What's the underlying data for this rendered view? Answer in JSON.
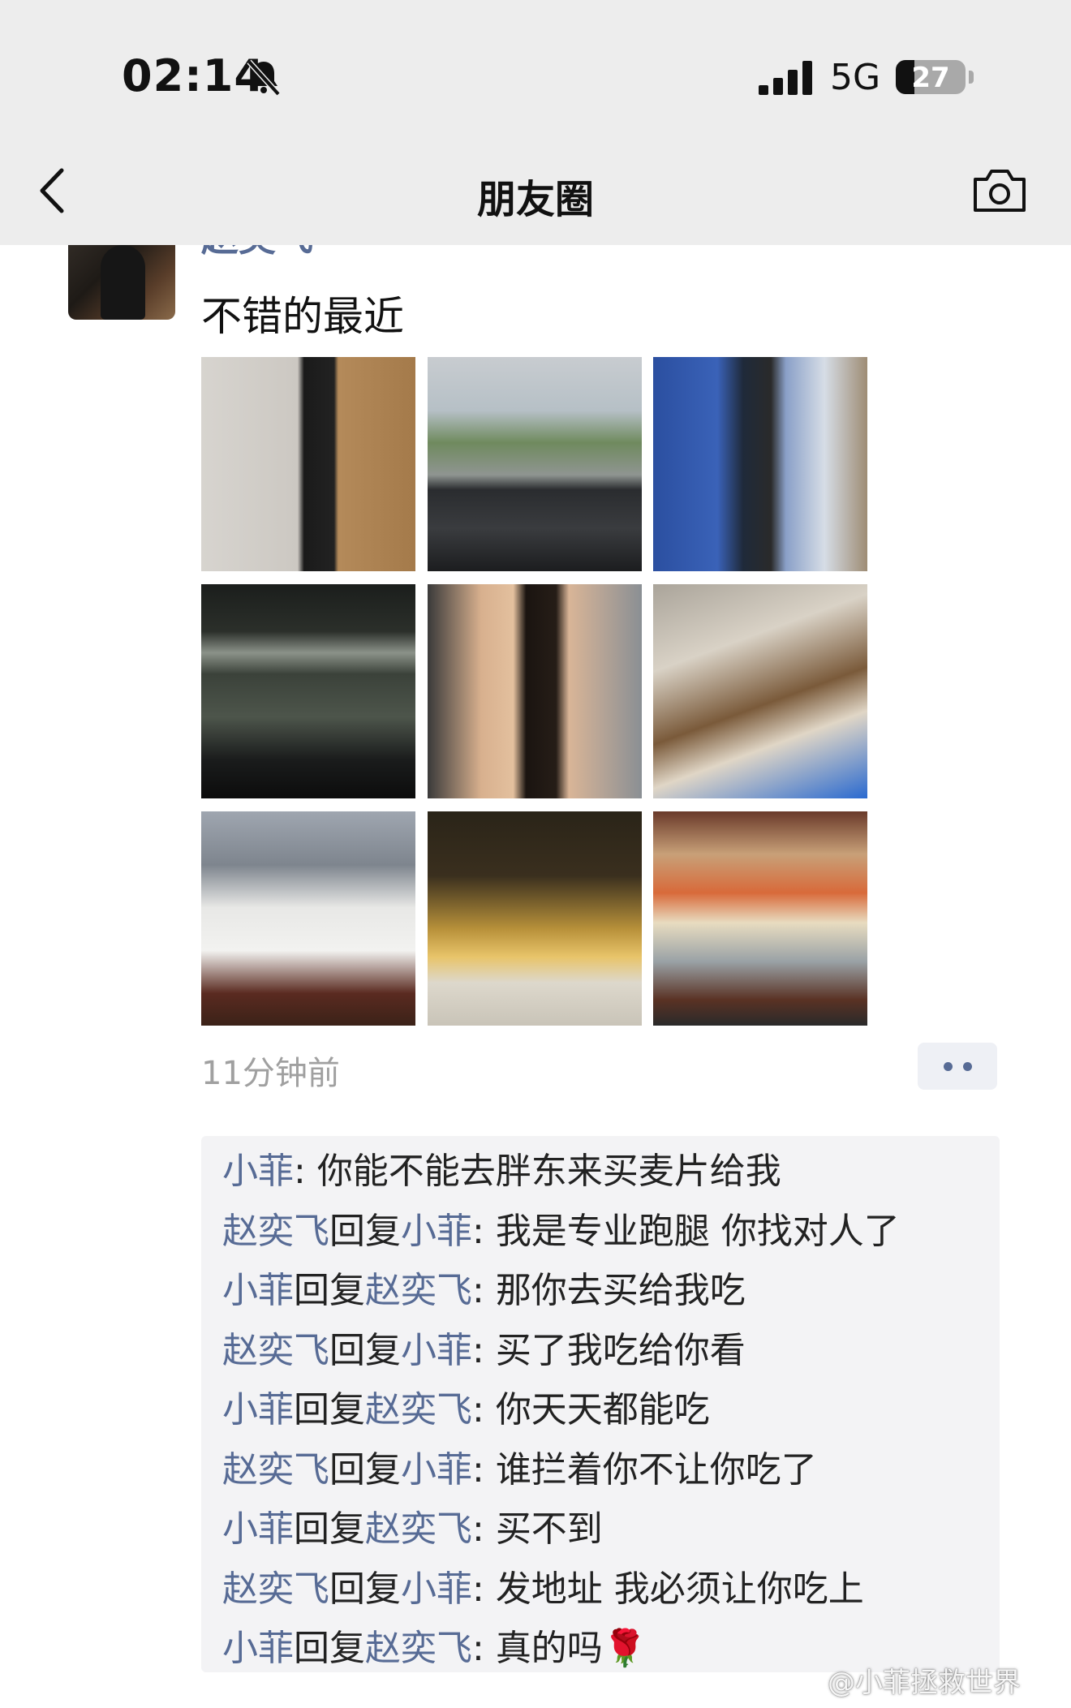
{
  "status_bar": {
    "time": "02:14",
    "network": "5G",
    "battery": "27",
    "battery_level": 0.27
  },
  "nav": {
    "title": "朋友圈"
  },
  "post": {
    "author": "赵奕飞",
    "text": "不错的最近",
    "timestamp": "11分钟前"
  },
  "comments": [
    {
      "name": "小菲",
      "reply_word": "",
      "reply_to": "",
      "sep": ": ",
      "text": "你能不能去胖东来买麦片给我"
    },
    {
      "name": "赵奕飞",
      "reply_word": "回复",
      "reply_to": "小菲",
      "sep": ": ",
      "text": "我是专业跑腿 你找对人了"
    },
    {
      "name": "小菲",
      "reply_word": "回复",
      "reply_to": "赵奕飞",
      "sep": ": ",
      "text": "那你去买给我吃"
    },
    {
      "name": "赵奕飞",
      "reply_word": "回复",
      "reply_to": "小菲",
      "sep": ": ",
      "text": "买了我吃给你看"
    },
    {
      "name": "小菲",
      "reply_word": "回复",
      "reply_to": "赵奕飞",
      "sep": ": ",
      "text": "你天天都能吃"
    },
    {
      "name": "赵奕飞",
      "reply_word": "回复",
      "reply_to": "小菲",
      "sep": ": ",
      "text": "谁拦着你不让你吃了"
    },
    {
      "name": "小菲",
      "reply_word": "回复",
      "reply_to": "赵奕飞",
      "sep": ": ",
      "text": "买不到"
    },
    {
      "name": "赵奕飞",
      "reply_word": "回复",
      "reply_to": "小菲",
      "sep": ": ",
      "text": "发地址 我必须让你吃上"
    },
    {
      "name": "小菲",
      "reply_word": "回复",
      "reply_to": "赵奕飞",
      "sep": ": ",
      "text": "真的吗🌹"
    }
  ],
  "watermark": "@小菲拯救世界",
  "colors": {
    "link": "#576b95",
    "nav_bg": "#ededed",
    "comment_bg": "#f3f3f5"
  }
}
